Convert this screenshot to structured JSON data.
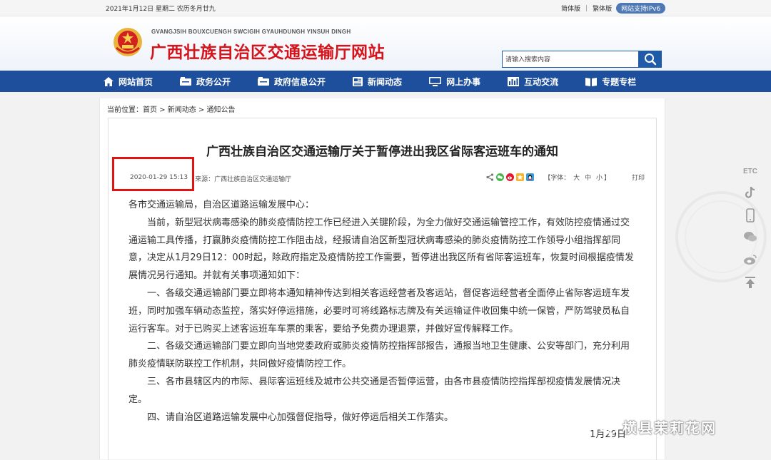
{
  "topbar": {
    "date": "2021年1月12日 星期二 农历冬月廿九",
    "simplified": "简体版",
    "traditional": "繁体版",
    "ipv6": "网站支持IPv6"
  },
  "header": {
    "pinyin": "GVANGJSIH BOUXCUENGH SWCIGIH GYAUHDUNGH YINSUH DINGH",
    "title": "广西壮族自治区交通运输厅网站",
    "search_placeholder": "请输入搜索内容"
  },
  "nav": [
    {
      "label": "网站首页",
      "icon": "home-icon"
    },
    {
      "label": "政务公开",
      "icon": "folder-icon"
    },
    {
      "label": "政府信息公开",
      "icon": "folder-icon"
    },
    {
      "label": "新闻动态",
      "icon": "news-icon"
    },
    {
      "label": "网上办事",
      "icon": "monitor-icon"
    },
    {
      "label": "互动交流",
      "icon": "chart-icon"
    },
    {
      "label": "专题专栏",
      "icon": "book-icon"
    }
  ],
  "breadcrumb": {
    "prefix": "当前位置：",
    "home": "首页",
    "sep": " > ",
    "news": "新闻动态",
    "notice": "通知公告"
  },
  "article": {
    "title": "广西壮族自治区交通运输厅关于暂停进出我区省际客运班车的通知",
    "datetime": "2020-01-29 15:13",
    "source": "来源：广西壮族自治区交通运输厅",
    "font_label": "【字体：",
    "font_large": "大",
    "font_medium": "中",
    "font_small": "小",
    "font_close": "】",
    "print": "打印",
    "greeting": "各市交通运输局，自治区道路运输发展中心：",
    "paragraphs": [
      "当前，新型冠状病毒感染的肺炎疫情防控工作已经进入关键阶段，为全力做好交通运输管控工作，有效防控疫情通过交通运输工具传播，打赢肺炎疫情防控工作阻击战，经报请自治区新型冠状病毒感染的肺炎疫情防控工作领导小组指挥部同意，决定从1月29日12：00时起，除政府指定及疫情防控工作需要，暂停进出我区所有省际客运班车，恢复时间根据疫情发展情况另行通知。并就有关事项通知如下：",
      "一、各级交通运输部门要立即将本通知精神传达到相关客运经营者及客运站，督促客运经营者全面停止省际客运班车发班，同时加强车辆动态监控，落实好停运措施，必要时可将线路标志牌及有关运输证件收回集中统一保管，严防驾驶员私自运行客车。对于已购买上述客运班车车票的乘客，要给予免费办理退票，并做好宣传解释工作。",
      "二、各级交通运输部门要立即向当地党委政府或肺炎疫情防控指挥部报告，通报当地卫生健康、公安等部门，充分利用肺炎疫情联防联控工作机制，共同做好疫情防控工作。",
      "三、各市县辖区内的市际、县际客运班线及城市公共交通是否暂停运营，由各市县疫情防控指挥部视疫情发展情况决定。",
      "四、请自治区道路运输发展中心加强督促指导，做好停运后相关工作落实。"
    ],
    "signature": "1月29日"
  },
  "side": {
    "etc": "ETC"
  },
  "watermark": {
    "text": "横县茉莉花网"
  },
  "colors": {
    "nav_bg": "#1d4f9c",
    "title_red": "#d4141b",
    "highlight_box": "#e11414"
  }
}
